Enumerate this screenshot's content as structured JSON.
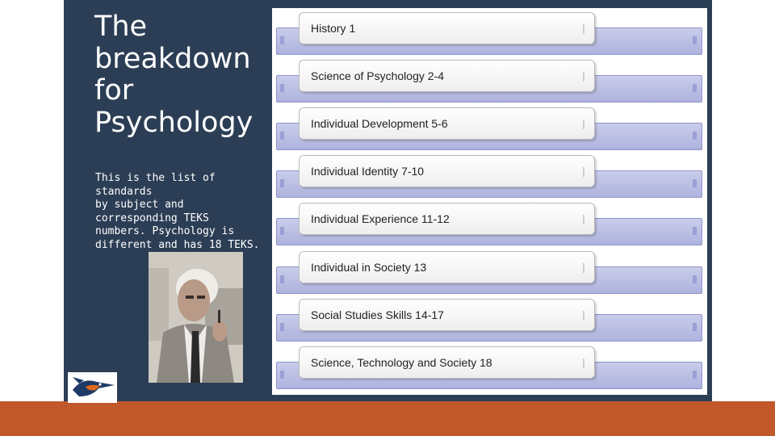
{
  "slide": {
    "title_lines": [
      "The",
      "breakdown",
      "for",
      "Psychology"
    ],
    "description": "This is the list of standards\nby subject and\ncorresponding TEKS\nnumbers.  Psychology is\ndifferent and has 18 TEKS."
  },
  "standards": [
    "History 1",
    "Science of Psychology 2-4",
    "Individual Development 5-6",
    "Individual Identity 7-10",
    "Individual Experience 11-12",
    "Individual in Society 13",
    "Social Studies Skills 14-17",
    "Science, Technology and Society 18"
  ],
  "colors": {
    "panel": "#2c3e55",
    "accent_bar": "#c0582a",
    "band": "#b8bde3"
  },
  "icons": {
    "photo": "portrait-photo",
    "logo": "roadrunner-logo"
  }
}
